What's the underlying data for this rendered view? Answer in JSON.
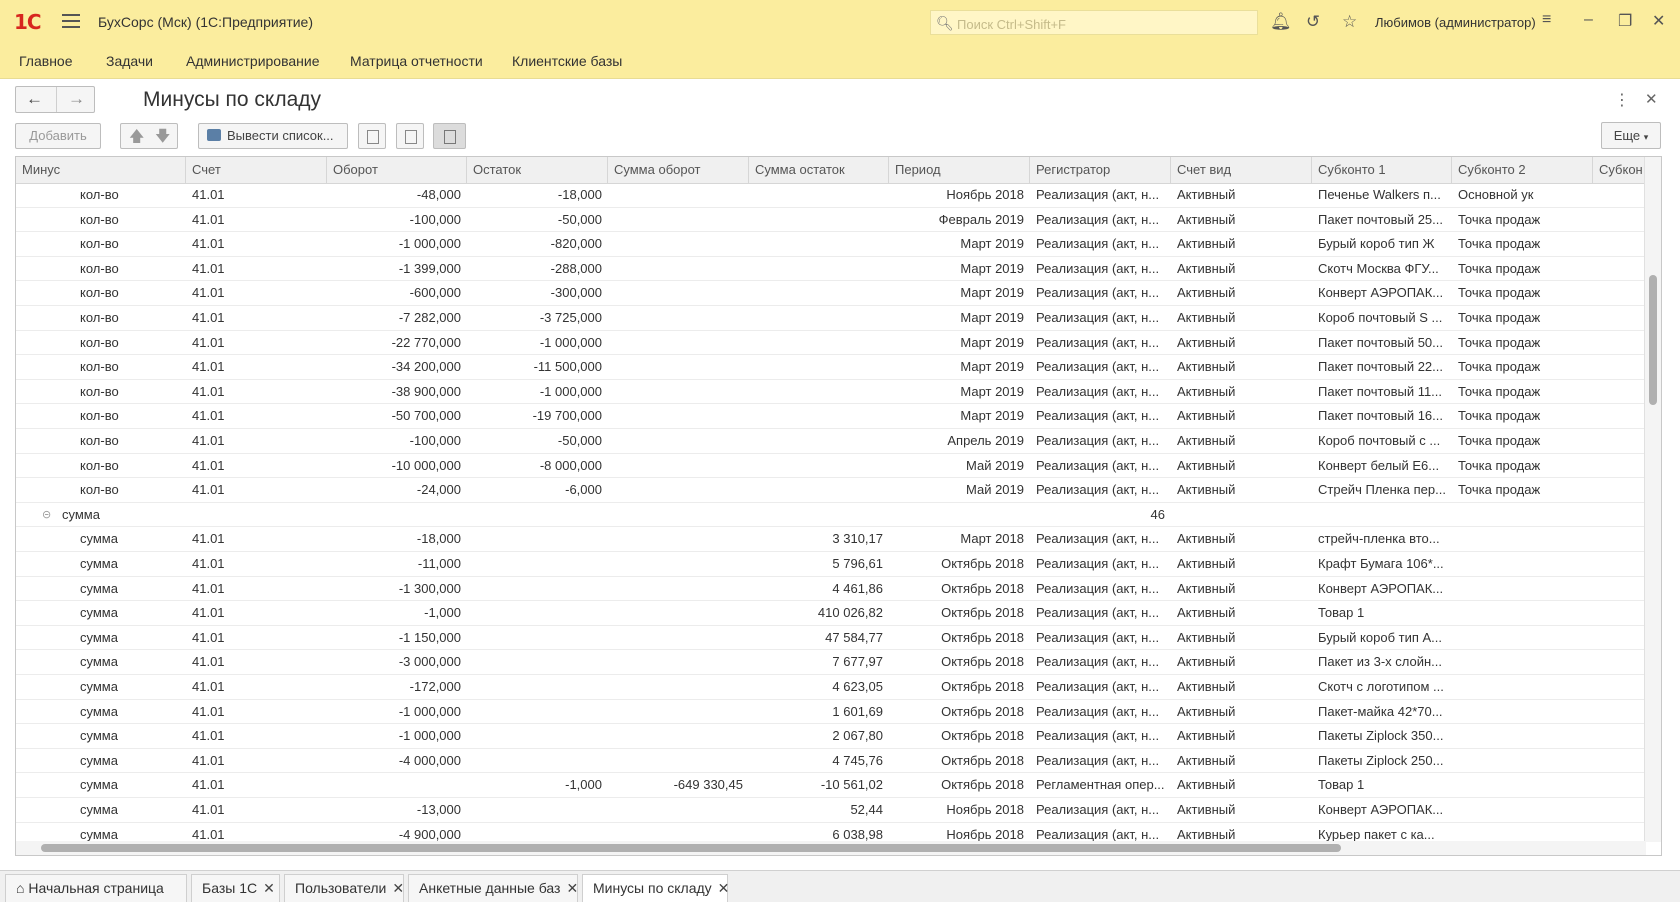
{
  "app": {
    "title": "БухСорс (Мск)  (1С:Предприятие)",
    "logo": "1С",
    "search_placeholder": "Поиск Ctrl+Shift+F",
    "user": "Любимов (администратор)",
    "accent_color": "#fbed9e"
  },
  "menu": [
    "Главное",
    "Задачи",
    "Администрирование",
    "Матрица отчетности",
    "Клиентские базы"
  ],
  "page": {
    "title": "Минусы по складу",
    "add_label": "Добавить",
    "export_label": "Вывести список...",
    "more_label": "Еще"
  },
  "columns": [
    "Минус",
    "Счет",
    "Оборот",
    "Остаток",
    "Сумма оборот",
    "Сумма остаток",
    "Период",
    "Регистратор",
    "Счет вид",
    "Субконто 1",
    "Субконто 2",
    "Субкон"
  ],
  "rows": [
    {
      "minus": "кол-во",
      "schet": "41.01",
      "oborot": "-48,000",
      "ostatok": "-18,000",
      "sum_ob": "",
      "sum_ost": "",
      "period": "Ноябрь 2018",
      "reg": "Реализация (акт, н...",
      "vid": "Активный",
      "sub1": "Печенье Walkers п...",
      "sub2": "Основной ук"
    },
    {
      "minus": "кол-во",
      "schet": "41.01",
      "oborot": "-100,000",
      "ostatok": "-50,000",
      "sum_ob": "",
      "sum_ost": "",
      "period": "Февраль 2019",
      "reg": "Реализация (акт, н...",
      "vid": "Активный",
      "sub1": "Пакет почтовый 25...",
      "sub2": "Точка продаж"
    },
    {
      "minus": "кол-во",
      "schet": "41.01",
      "oborot": "-1 000,000",
      "ostatok": "-820,000",
      "sum_ob": "",
      "sum_ost": "",
      "period": "Март 2019",
      "reg": "Реализация (акт, н...",
      "vid": "Активный",
      "sub1": "Бурый короб тип Ж",
      "sub2": "Точка продаж"
    },
    {
      "minus": "кол-во",
      "schet": "41.01",
      "oborot": "-1 399,000",
      "ostatok": "-288,000",
      "sum_ob": "",
      "sum_ost": "",
      "period": "Март 2019",
      "reg": "Реализация (акт, н...",
      "vid": "Активный",
      "sub1": "Скотч Москва ФГУ...",
      "sub2": "Точка продаж"
    },
    {
      "minus": "кол-во",
      "schet": "41.01",
      "oborot": "-600,000",
      "ostatok": "-300,000",
      "sum_ob": "",
      "sum_ost": "",
      "period": "Март 2019",
      "reg": "Реализация (акт, н...",
      "vid": "Активный",
      "sub1": "Конверт АЭРОПАК...",
      "sub2": "Точка продаж"
    },
    {
      "minus": "кол-во",
      "schet": "41.01",
      "oborot": "-7 282,000",
      "ostatok": "-3 725,000",
      "sum_ob": "",
      "sum_ost": "",
      "period": "Март 2019",
      "reg": "Реализация (акт, н...",
      "vid": "Активный",
      "sub1": "Короб почтовый S ...",
      "sub2": "Точка продаж"
    },
    {
      "minus": "кол-во",
      "schet": "41.01",
      "oborot": "-22 770,000",
      "ostatok": "-1 000,000",
      "sum_ob": "",
      "sum_ost": "",
      "period": "Март 2019",
      "reg": "Реализация (акт, н...",
      "vid": "Активный",
      "sub1": "Пакет почтовый 50...",
      "sub2": "Точка продаж"
    },
    {
      "minus": "кол-во",
      "schet": "41.01",
      "oborot": "-34 200,000",
      "ostatok": "-11 500,000",
      "sum_ob": "",
      "sum_ost": "",
      "period": "Март 2019",
      "reg": "Реализация (акт, н...",
      "vid": "Активный",
      "sub1": "Пакет почтовый 22...",
      "sub2": "Точка продаж"
    },
    {
      "minus": "кол-во",
      "schet": "41.01",
      "oborot": "-38 900,000",
      "ostatok": "-1 000,000",
      "sum_ob": "",
      "sum_ost": "",
      "period": "Март 2019",
      "reg": "Реализация (акт, н...",
      "vid": "Активный",
      "sub1": "Пакет почтовый 11...",
      "sub2": "Точка продаж"
    },
    {
      "minus": "кол-во",
      "schet": "41.01",
      "oborot": "-50 700,000",
      "ostatok": "-19 700,000",
      "sum_ob": "",
      "sum_ost": "",
      "period": "Март 2019",
      "reg": "Реализация (акт, н...",
      "vid": "Активный",
      "sub1": "Пакет почтовый 16...",
      "sub2": "Точка продаж"
    },
    {
      "minus": "кол-во",
      "schet": "41.01",
      "oborot": "-100,000",
      "ostatok": "-50,000",
      "sum_ob": "",
      "sum_ost": "",
      "period": "Апрель 2019",
      "reg": "Реализация (акт, н...",
      "vid": "Активный",
      "sub1": "Короб почтовый с ...",
      "sub2": "Точка продаж"
    },
    {
      "minus": "кол-во",
      "schet": "41.01",
      "oborot": "-10 000,000",
      "ostatok": "-8 000,000",
      "sum_ob": "",
      "sum_ost": "",
      "period": "Май 2019",
      "reg": "Реализация (акт, н...",
      "vid": "Активный",
      "sub1": "Конверт белый Е6...",
      "sub2": "Точка продаж"
    },
    {
      "minus": "кол-во",
      "schet": "41.01",
      "oborot": "-24,000",
      "ostatok": "-6,000",
      "sum_ob": "",
      "sum_ost": "",
      "period": "Май 2019",
      "reg": "Реализация (акт, н...",
      "vid": "Активный",
      "sub1": "Стрейч Пленка пер...",
      "sub2": "Точка продаж"
    },
    {
      "group": true,
      "minus": "сумма",
      "count": "46"
    },
    {
      "minus": "сумма",
      "schet": "41.01",
      "oborot": "-18,000",
      "ostatok": "",
      "sum_ob": "",
      "sum_ost": "3 310,17",
      "period": "Март 2018",
      "reg": "Реализация (акт, н...",
      "vid": "Активный",
      "sub1": "стрейч-пленка вто...",
      "sub2": ""
    },
    {
      "minus": "сумма",
      "schet": "41.01",
      "oborot": "-11,000",
      "ostatok": "",
      "sum_ob": "",
      "sum_ost": "5 796,61",
      "period": "Октябрь 2018",
      "reg": "Реализация (акт, н...",
      "vid": "Активный",
      "sub1": "Крафт Бумага 106*...",
      "sub2": ""
    },
    {
      "minus": "сумма",
      "schet": "41.01",
      "oborot": "-1 300,000",
      "ostatok": "",
      "sum_ob": "",
      "sum_ost": "4 461,86",
      "period": "Октябрь 2018",
      "reg": "Реализация (акт, н...",
      "vid": "Активный",
      "sub1": "Конверт АЭРОПАК...",
      "sub2": ""
    },
    {
      "minus": "сумма",
      "schet": "41.01",
      "oborot": "-1,000",
      "ostatok": "",
      "sum_ob": "",
      "sum_ost": "410 026,82",
      "period": "Октябрь 2018",
      "reg": "Реализация (акт, н...",
      "vid": "Активный",
      "sub1": "Товар 1",
      "sub2": ""
    },
    {
      "minus": "сумма",
      "schet": "41.01",
      "oborot": "-1 150,000",
      "ostatok": "",
      "sum_ob": "",
      "sum_ost": "47 584,77",
      "period": "Октябрь 2018",
      "reg": "Реализация (акт, н...",
      "vid": "Активный",
      "sub1": "Бурый короб тип А...",
      "sub2": ""
    },
    {
      "minus": "сумма",
      "schet": "41.01",
      "oborot": "-3 000,000",
      "ostatok": "",
      "sum_ob": "",
      "sum_ost": "7 677,97",
      "period": "Октябрь 2018",
      "reg": "Реализация (акт, н...",
      "vid": "Активный",
      "sub1": "Пакет из 3-х слойн...",
      "sub2": ""
    },
    {
      "minus": "сумма",
      "schet": "41.01",
      "oborot": "-172,000",
      "ostatok": "",
      "sum_ob": "",
      "sum_ost": "4 623,05",
      "period": "Октябрь 2018",
      "reg": "Реализация (акт, н...",
      "vid": "Активный",
      "sub1": "Скотч с логотипом ...",
      "sub2": ""
    },
    {
      "minus": "сумма",
      "schet": "41.01",
      "oborot": "-1 000,000",
      "ostatok": "",
      "sum_ob": "",
      "sum_ost": "1 601,69",
      "period": "Октябрь 2018",
      "reg": "Реализация (акт, н...",
      "vid": "Активный",
      "sub1": "Пакет-майка 42*70...",
      "sub2": ""
    },
    {
      "minus": "сумма",
      "schet": "41.01",
      "oborot": "-1 000,000",
      "ostatok": "",
      "sum_ob": "",
      "sum_ost": "2 067,80",
      "period": "Октябрь 2018",
      "reg": "Реализация (акт, н...",
      "vid": "Активный",
      "sub1": "Пакеты Ziplock 350...",
      "sub2": ""
    },
    {
      "minus": "сумма",
      "schet": "41.01",
      "oborot": "-4 000,000",
      "ostatok": "",
      "sum_ob": "",
      "sum_ost": "4 745,76",
      "period": "Октябрь 2018",
      "reg": "Реализация (акт, н...",
      "vid": "Активный",
      "sub1": "Пакеты Ziplock 250...",
      "sub2": ""
    },
    {
      "minus": "сумма",
      "schet": "41.01",
      "oborot": "",
      "ostatok": "-1,000",
      "sum_ob": "-649 330,45",
      "sum_ost": "-10 561,02",
      "period": "Октябрь 2018",
      "reg": "Регламентная опер...",
      "vid": "Активный",
      "sub1": "Товар 1",
      "sub2": ""
    },
    {
      "minus": "сумма",
      "schet": "41.01",
      "oborot": "-13,000",
      "ostatok": "",
      "sum_ob": "",
      "sum_ost": "52,44",
      "period": "Ноябрь 2018",
      "reg": "Реализация (акт, н...",
      "vid": "Активный",
      "sub1": "Конверт АЭРОПАК...",
      "sub2": ""
    },
    {
      "minus": "сумма",
      "schet": "41.01",
      "oborot": "-4 900,000",
      "ostatok": "",
      "sum_ob": "",
      "sum_ost": "6 038,98",
      "period": "Ноябрь 2018",
      "reg": "Реализация (акт, н...",
      "vid": "Активный",
      "sub1": "Курьер пакет  с ка...",
      "sub2": ""
    }
  ],
  "tabs": [
    {
      "label": "Начальная страница",
      "closable": false,
      "active": false
    },
    {
      "label": "Базы 1С",
      "closable": true,
      "active": false
    },
    {
      "label": "Пользователи",
      "closable": true,
      "active": false
    },
    {
      "label": "Анкетные данные баз",
      "closable": true,
      "active": false
    },
    {
      "label": "Минусы по складу",
      "closable": true,
      "active": true
    }
  ]
}
